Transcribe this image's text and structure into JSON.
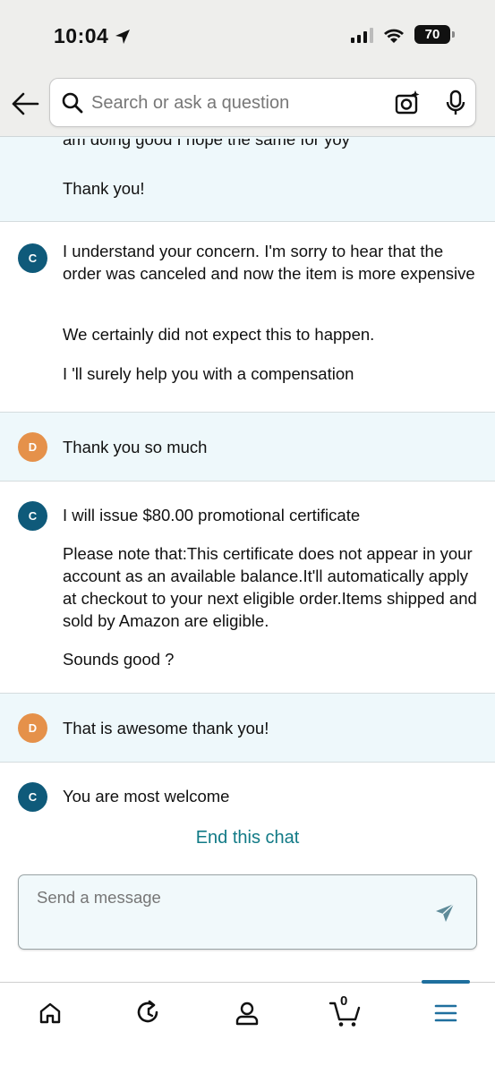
{
  "status_bar": {
    "time": "10:04",
    "battery": "70"
  },
  "header": {
    "search_placeholder": "Search or ask a question"
  },
  "chat": {
    "messages": [
      {
        "sender": "customer",
        "partial_line": "am doing good I hope the same for yoy",
        "paragraphs": [
          "Thank you!"
        ]
      },
      {
        "sender": "agent",
        "avatar": "C",
        "paragraphs": [
          "I understand your concern. I'm sorry to hear that the order was canceled and now the item is more expensive",
          "We certainly did not expect this to happen.",
          "I 'll surely help you with a compensation"
        ]
      },
      {
        "sender": "customer",
        "avatar": "D",
        "paragraphs": [
          "Thank you so much"
        ]
      },
      {
        "sender": "agent",
        "avatar": "C",
        "paragraphs": [
          "I will issue $80.00 promotional certificate",
          "Please note that:This certificate does not appear in your account as an available balance.It'll automatically apply at checkout to your next eligible order.Items shipped and sold by Amazon are eligible.",
          "Sounds good ?"
        ]
      },
      {
        "sender": "customer",
        "avatar": "D",
        "paragraphs": [
          "That is awesome thank you!"
        ]
      },
      {
        "sender": "agent",
        "avatar": "C",
        "paragraphs": [
          "You are most welcome"
        ]
      }
    ],
    "end_chat_label": "End this chat"
  },
  "composer": {
    "placeholder": "Send a message"
  },
  "bottom_nav": {
    "items": [
      {
        "icon": "home-icon"
      },
      {
        "icon": "refresh-icon"
      },
      {
        "icon": "account-icon"
      },
      {
        "icon": "cart-icon",
        "count": "0"
      },
      {
        "icon": "menu-icon",
        "active": true
      }
    ],
    "accent_color": "#1f6f9e"
  },
  "colors": {
    "agent_avatar": "#0f5a7a",
    "customer_avatar": "#e5914a",
    "customer_bg": "#eef8fb",
    "link": "#117a86"
  }
}
